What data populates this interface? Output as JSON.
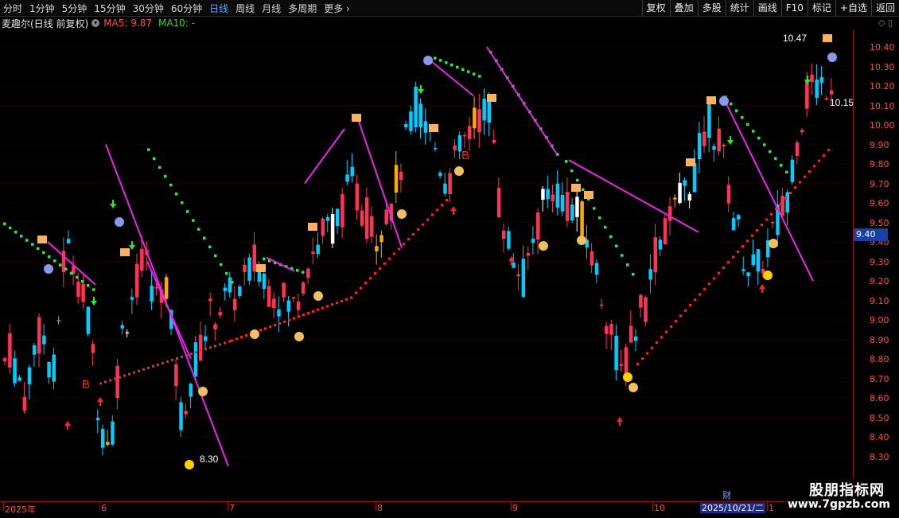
{
  "toolbar": {
    "periods": [
      "分时",
      "1分钟",
      "5分钟",
      "15分钟",
      "30分钟",
      "60分钟",
      "日线",
      "周线",
      "月线",
      "多周期",
      "更多"
    ],
    "active_period": "日线",
    "more_glyph": "›",
    "right_buttons": [
      "复权",
      "叠加",
      "多股",
      "统计",
      "画线",
      "F10",
      "标记",
      "+自选",
      "返回"
    ]
  },
  "stock": {
    "title": "麦趣尔(日线 前复权)",
    "ma5": "MA5: 9.87",
    "ma10": "MA10: -"
  },
  "axis": {
    "ticks": [
      "10.40",
      "10.30",
      "10.20",
      "10.10",
      "10.00",
      "9.90",
      "9.80",
      "9.70",
      "9.60",
      "9.50",
      "9.40",
      "9.30",
      "9.20",
      "9.10",
      "9.00",
      "8.90",
      "8.80",
      "8.70",
      "8.60",
      "8.50",
      "8.40",
      "8.30"
    ],
    "current_price": "9.40",
    "x_labels": [
      "2025年",
      "6",
      "7",
      "8",
      "9",
      "10",
      "1"
    ],
    "cursor_date": "2025/10/21/二",
    "cai_label": "财"
  },
  "annotations": {
    "high_label": "10.47",
    "low_label": "8.30",
    "right_label": "10.15",
    "b_labels": [
      "B",
      "B"
    ]
  },
  "watermark": {
    "line1": "股朋指标网",
    "line2": "www.7gpzb.com"
  },
  "colors": {
    "up": "#ff3355",
    "down": "#00ccff",
    "support_dots": "#ff2222",
    "resist_dots": "#22ee44",
    "trend_line": "#ee22ee"
  }
}
